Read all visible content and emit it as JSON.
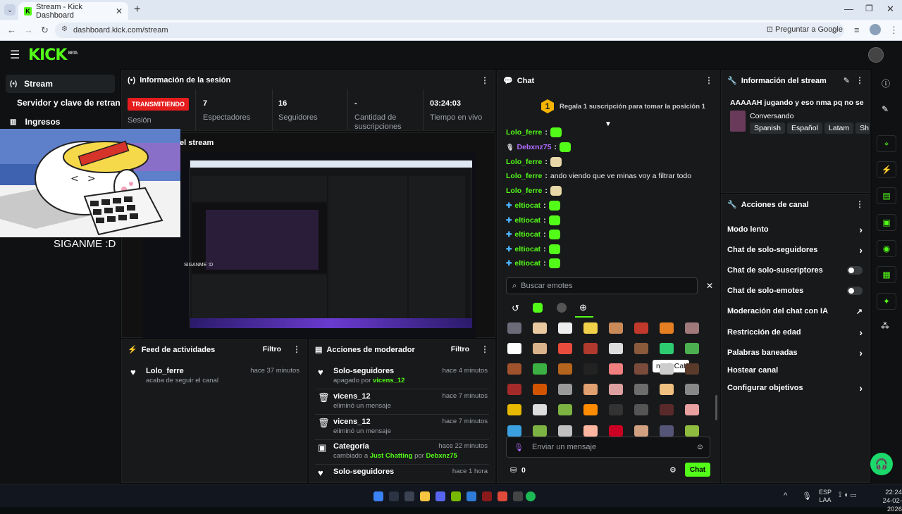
{
  "browser": {
    "tab_title": "Stream - Kick Dashboard",
    "url": "dashboard.kick.com/stream",
    "ask_google": "Preguntar a Google"
  },
  "header": {
    "logo": "KICK",
    "logo_badge": "BETA"
  },
  "sidebar": {
    "items": [
      {
        "label": "Stream",
        "icon": "broadcast-icon"
      },
      {
        "label": "Servidor y clave de retransm",
        "icon": ""
      },
      {
        "label": "Ingresos",
        "icon": "chart-icon"
      }
    ]
  },
  "session": {
    "title": "Información de la sesión",
    "status": "TRANSMITIENDO",
    "session_label": "Sesión",
    "stats": [
      {
        "value": "7",
        "label": "Espectadores"
      },
      {
        "value": "16",
        "label": "Seguidores"
      },
      {
        "value": "-",
        "label": "Cantidad de suscripciones"
      },
      {
        "value": "03:24:03",
        "label": "Tiempo en vivo"
      }
    ]
  },
  "preview": {
    "title_fragment": "el stream",
    "overlay_text": "SIGANME :D",
    "overlay_text_small": "SIGANME :D"
  },
  "chat": {
    "title": "Chat",
    "gift_rank": "1",
    "gift_text": "Regala 1 suscripción para tomar la posición 1",
    "messages": [
      {
        "user": "Lolo_ferre",
        "text": "",
        "color": "#53fc18",
        "emote": "green"
      },
      {
        "user": "Debxnz75",
        "text": "",
        "color": "#b26cff",
        "emote": "green"
      },
      {
        "user": "Lolo_ferre",
        "text": "",
        "color": "#53fc18",
        "emote": "img"
      },
      {
        "user": "Lolo_ferre",
        "text": "ando viendo que ve minas voy a filtrar todo",
        "color": "#53fc18",
        "emote": ""
      },
      {
        "user": "Lolo_ferre",
        "text": "",
        "color": "#53fc18",
        "emote": "img"
      },
      {
        "user": "eltiocat",
        "text": "",
        "color": "#53fc18",
        "emote": "green"
      },
      {
        "user": "eltiocat",
        "text": "",
        "color": "#53fc18",
        "emote": "green"
      },
      {
        "user": "eltiocat",
        "text": "",
        "color": "#53fc18",
        "emote": "green"
      },
      {
        "user": "eltiocat",
        "text": "",
        "color": "#53fc18",
        "emote": "green"
      },
      {
        "user": "eltiocat",
        "text": "",
        "color": "#53fc18",
        "emote": "green"
      }
    ],
    "emote_search_placeholder": "Buscar emotes",
    "tooltip": "mericCat",
    "message_placeholder": "Enviar un mensaje",
    "points": "0",
    "send_label": "Chat"
  },
  "stream_info": {
    "title": "Información del stream",
    "stream_title": "AAAAAH jugando y eso nma pq no se",
    "category": "Conversando",
    "tags": [
      "Spanish",
      "Español",
      "Latam",
      "Sh"
    ]
  },
  "channel_actions": {
    "title": "Acciones de canal",
    "items": [
      {
        "label": "Modo lento",
        "control": "chevron"
      },
      {
        "label": "Chat de solo-seguidores",
        "control": "chevron"
      },
      {
        "label": "Chat de solo-suscriptores",
        "control": "toggle"
      },
      {
        "label": "Chat de solo-emotes",
        "control": "toggle"
      },
      {
        "label": "Moderación del chat con IA",
        "control": "external"
      },
      {
        "label": "Restricción de edad",
        "control": "chevron"
      },
      {
        "label": "Palabras baneadas",
        "control": "chevron"
      },
      {
        "label": "Hostear canal",
        "control": "none"
      },
      {
        "label": "Configurar objetivos",
        "control": "chevron"
      }
    ]
  },
  "activity": {
    "title": "Feed de actividades",
    "filter": "Filtro",
    "items": [
      {
        "user": "Lolo_ferre",
        "sub": "acaba de seguir el canal",
        "time": "hace 37 minutos"
      }
    ]
  },
  "moderator": {
    "title": "Acciones de moderador",
    "filter": "Filtro",
    "items": [
      {
        "title": "Solo-seguidores",
        "sub_prefix": "apagado por ",
        "sub_highlight": "vicens_12",
        "time": "hace 4 minutos",
        "icon": "heart-icon"
      },
      {
        "title": "vicens_12",
        "sub_prefix": "eliminó un mensaje",
        "sub_highlight": "",
        "time": "hace 7 minutos",
        "icon": "trash-icon"
      },
      {
        "title": "vicens_12",
        "sub_prefix": "eliminó un mensaje",
        "sub_highlight": "",
        "time": "hace 7 minutos",
        "icon": "trash-icon"
      },
      {
        "title": "Categoría",
        "sub_prefix": "cambiado a ",
        "sub_highlight": "Just Chatting",
        "sub_mid": " por ",
        "sub_highlight2": "Debxnz75",
        "time": "hace 22 minutos",
        "icon": "category-icon"
      },
      {
        "title": "Solo-seguidores",
        "sub_prefix": "",
        "sub_highlight": "",
        "time": "hace 1 hora",
        "icon": "heart-icon"
      }
    ]
  },
  "taskbar": {
    "lang": "ESP",
    "lang2": "LAA",
    "time": "22:24",
    "date": "24-02-2026"
  }
}
